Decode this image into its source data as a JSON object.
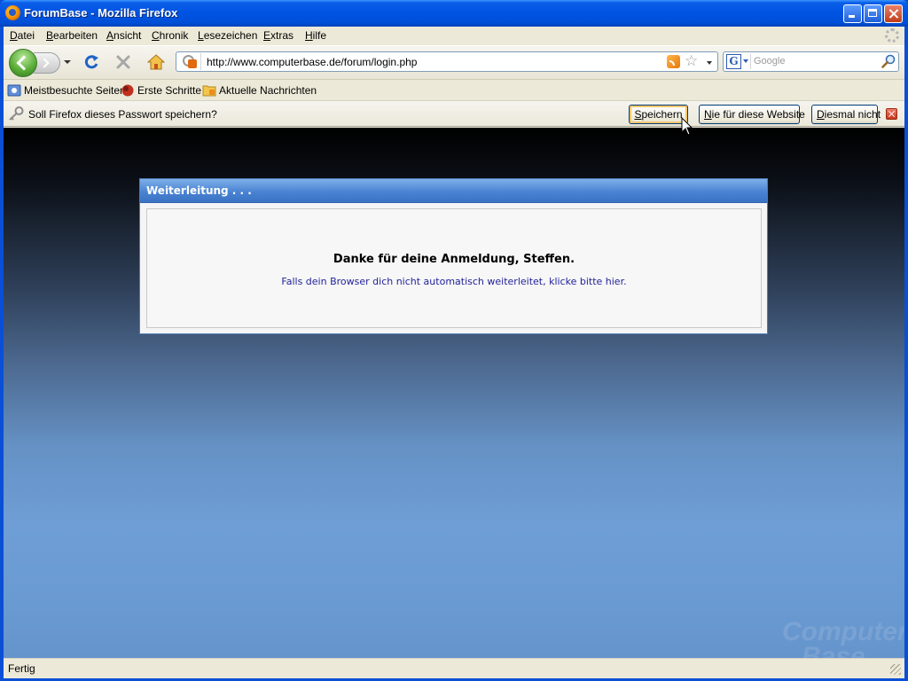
{
  "window": {
    "title": "ForumBase - Mozilla Firefox"
  },
  "menubar": {
    "items": [
      {
        "accel": "D",
        "rest": "atei"
      },
      {
        "accel": "B",
        "rest": "earbeiten"
      },
      {
        "accel": "A",
        "rest": "nsicht"
      },
      {
        "accel": "C",
        "rest": "hronik"
      },
      {
        "accel": "L",
        "rest": "esezeichen"
      },
      {
        "accel": "E",
        "rest": "xtras"
      },
      {
        "accel": "H",
        "rest": "ilfe"
      }
    ]
  },
  "navbar": {
    "url": "http://www.computerbase.de/forum/login.php",
    "search_placeholder": "Google",
    "search_engine_letter": "G"
  },
  "bookmarks": {
    "items": [
      {
        "label": "Meistbesuchte Seiten",
        "icon": "smart-folder-icon"
      },
      {
        "label": "Erste Schritte",
        "icon": "firefox-bookmark-icon"
      },
      {
        "label": "Aktuelle Nachrichten",
        "icon": "rss-folder-icon"
      }
    ]
  },
  "notification": {
    "text": "Soll Firefox dieses Passwort speichern?",
    "buttons": {
      "save": {
        "accel": "S",
        "rest": "peichern"
      },
      "never": {
        "accel": "N",
        "rest": "ie für diese Website"
      },
      "not_now": {
        "accel": "D",
        "rest": "iesmal nicht"
      }
    }
  },
  "page": {
    "box_title": "Weiterleitung . . .",
    "thanks": "Danke für deine Anmeldung, Steffen.",
    "redirect_link": "Falls dein Browser dich nicht automatisch weiterleitet, klicke bitte hier.",
    "watermark_line1": "Computer",
    "watermark_line2": "Base"
  },
  "status": {
    "text": "Fertig"
  },
  "colors": {
    "titlebar": "#0053e2",
    "box_header": "#4a83d2",
    "link": "#22229c"
  }
}
